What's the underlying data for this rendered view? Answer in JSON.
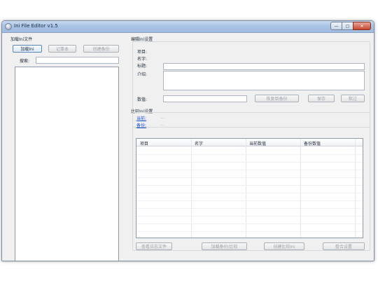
{
  "window": {
    "title": "Ini File Editor v1.5"
  },
  "left": {
    "group_label": "加载Ini文件",
    "load_button": "加载Ini",
    "notepad_button": "记事本",
    "backup_button": "创建备份",
    "search_label": "搜索:",
    "search_value": ""
  },
  "edit": {
    "group_label": "编辑Ini设置",
    "item_label": "项目:",
    "name_label": "名字:",
    "title_label": "标题:",
    "intro_label": "介绍:",
    "value_label": "数值:",
    "title_value": "",
    "intro_value": "",
    "value_value": "",
    "restore_button": "恢复到备份",
    "save_button": "保存",
    "skip_button": "默过"
  },
  "compare": {
    "group_label": "比较Ini设置",
    "current_link": "当前:",
    "backup_link": "备份:",
    "current_value": "...",
    "backup_value": "..."
  },
  "table": {
    "columns": [
      "项目",
      "名字",
      "当前数值",
      "备份数值"
    ],
    "rows": []
  },
  "footer": {
    "log_button": "查看日志文件",
    "load_compare_button": "加载备份/比较",
    "create_compare_button": "创建比较Ini",
    "merge_button": "整合设置"
  }
}
